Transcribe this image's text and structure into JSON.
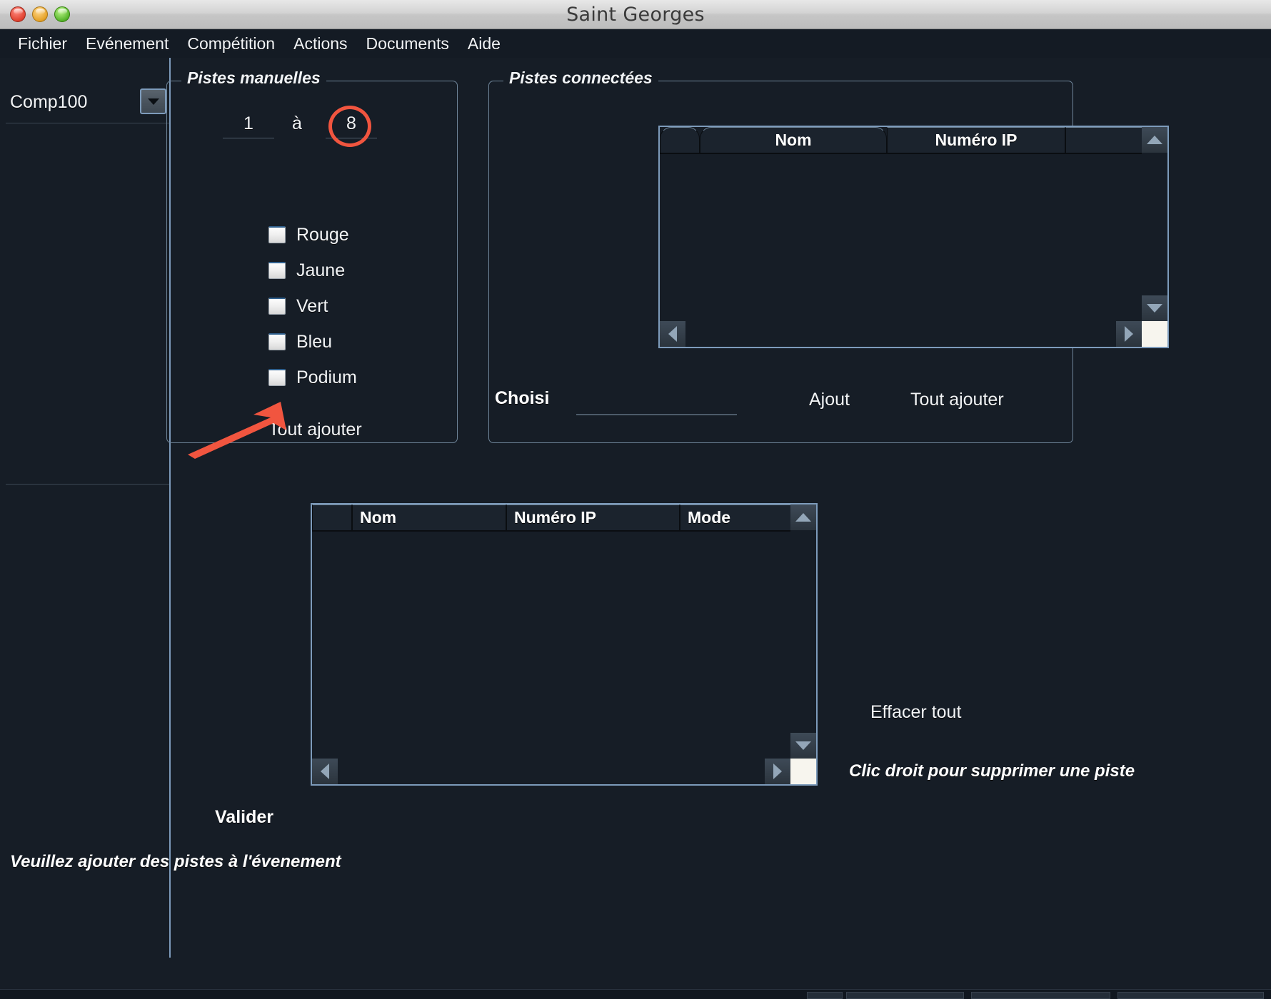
{
  "window": {
    "title": "Saint Georges",
    "controls": {
      "close": "close-button",
      "minimize": "minimize-button",
      "zoom": "zoom-button"
    }
  },
  "menubar": {
    "items": [
      {
        "label": "Fichier"
      },
      {
        "label": "Evénement"
      },
      {
        "label": "Compétition"
      },
      {
        "label": "Actions"
      },
      {
        "label": "Documents"
      },
      {
        "label": "Aide"
      }
    ]
  },
  "sidebar": {
    "competition_select": {
      "value": "Comp100",
      "icon": "chevron-down-icon"
    }
  },
  "manual_tracks": {
    "title": "Pistes manuelles",
    "range": {
      "from": "1",
      "separator": "à",
      "to": "8"
    },
    "options": [
      {
        "label": "Rouge",
        "checked": false
      },
      {
        "label": "Jaune",
        "checked": false
      },
      {
        "label": "Vert",
        "checked": false
      },
      {
        "label": "Bleu",
        "checked": false
      },
      {
        "label": "Podium",
        "checked": false
      }
    ],
    "add_all_label": "Tout ajouter"
  },
  "connected_tracks": {
    "title": "Pistes connectées",
    "table": {
      "columns": [
        "",
        "Nom",
        "Numéro IP"
      ],
      "rows": []
    },
    "chosen_label": "Choisi",
    "chosen_value": "",
    "add_label": "Ajout",
    "add_all_label": "Tout ajouter"
  },
  "tracks_table": {
    "columns": [
      "",
      "Nom",
      "Numéro IP",
      "Mode"
    ],
    "rows": []
  },
  "actions": {
    "clear_all_label": "Effacer tout",
    "right_click_hint": "Clic droit pour supprimer une piste",
    "validate_label": "Valider"
  },
  "status": {
    "message": "Veuillez ajouter des pistes à l'évenement"
  },
  "annotations": {
    "circle_target": "8",
    "arrow_target": "Tout ajouter",
    "color": "#f1553f"
  },
  "colors": {
    "background": "#161d26",
    "panel_border": "#6f8599",
    "accent_border": "#7d9bbb",
    "text": "#f2f4f6",
    "annotation": "#f1553f"
  }
}
